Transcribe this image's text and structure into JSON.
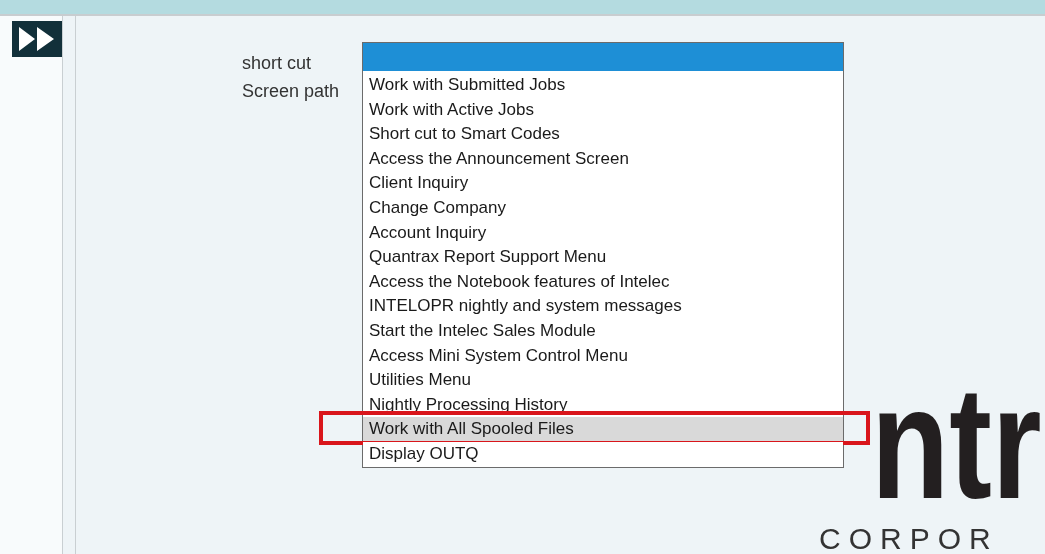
{
  "form": {
    "labels": [
      "short cut",
      "Screen path"
    ]
  },
  "dropdown": {
    "items": [
      {
        "label": "Work with Submitted Jobs",
        "highlighted": false,
        "annotated": false
      },
      {
        "label": "Work with Active Jobs",
        "highlighted": false,
        "annotated": false
      },
      {
        "label": "Short cut to Smart Codes",
        "highlighted": false,
        "annotated": false
      },
      {
        "label": "Access the Announcement Screen",
        "highlighted": false,
        "annotated": false
      },
      {
        "label": "Client Inquiry",
        "highlighted": false,
        "annotated": false
      },
      {
        "label": "Change Company",
        "highlighted": false,
        "annotated": false
      },
      {
        "label": "Account Inquiry",
        "highlighted": false,
        "annotated": false
      },
      {
        "label": "Quantrax Report Support Menu",
        "highlighted": false,
        "annotated": false
      },
      {
        "label": "Access the Notebook features of Intelec",
        "highlighted": false,
        "annotated": false
      },
      {
        "label": "INTELOPR nightly and system messages",
        "highlighted": false,
        "annotated": false
      },
      {
        "label": "Start the Intelec Sales Module",
        "highlighted": false,
        "annotated": false
      },
      {
        "label": "Access Mini System Control Menu",
        "highlighted": false,
        "annotated": false
      },
      {
        "label": "Utilities Menu",
        "highlighted": false,
        "annotated": false
      },
      {
        "label": "Nightly Processing History",
        "highlighted": false,
        "annotated": false
      },
      {
        "label": "Work with All Spooled Files",
        "highlighted": true,
        "annotated": true
      },
      {
        "label": "Display OUTQ",
        "highlighted": false,
        "annotated": false
      }
    ]
  },
  "logo": {
    "name": "ntr",
    "subtitle": "CORPOR"
  }
}
